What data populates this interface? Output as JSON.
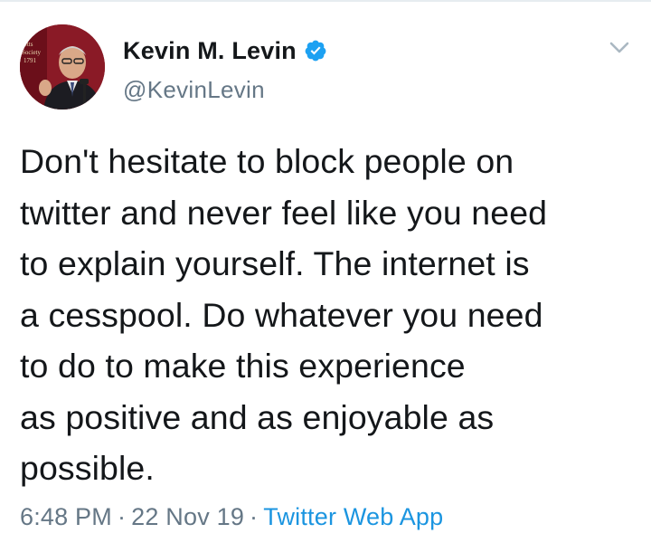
{
  "author": {
    "display_name": "Kevin M. Levin",
    "handle": "@KevinLevin",
    "avatar_banner_text": "setts Society 1791"
  },
  "icons": {
    "verified": "verified-badge-icon",
    "caret": "chevron-down-icon"
  },
  "tweet": {
    "lines": [
      "Don't hesitate to block people on",
      "twitter and never feel like you need",
      "to explain yourself. The internet is",
      "a cesspool. Do whatever you need",
      "to do to make this experience",
      "as positive and as enjoyable as",
      "possible."
    ]
  },
  "meta": {
    "time": "6:48 PM",
    "separator": "·",
    "date": "22 Nov 19",
    "source": "Twitter Web App"
  },
  "colors": {
    "text": "#14171a",
    "secondary": "#657786",
    "link": "#1b95e0",
    "verified": "#1da1f2"
  }
}
